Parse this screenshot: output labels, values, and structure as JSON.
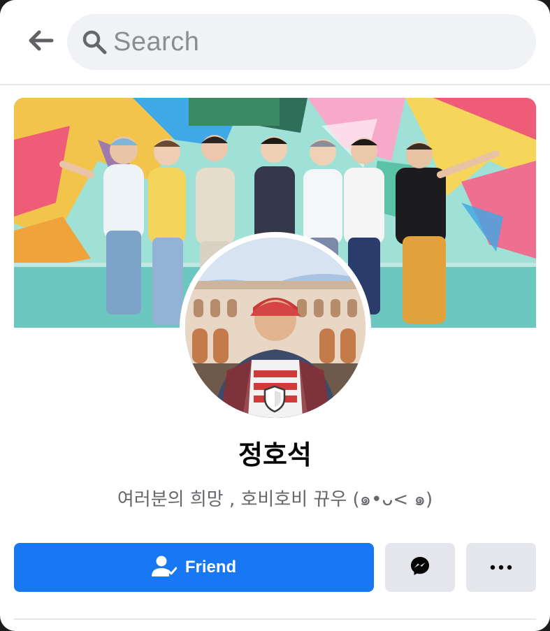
{
  "search": {
    "placeholder": "Search"
  },
  "profile": {
    "name": "정호석",
    "bio": "여러분의 희망 , 호비호비 뀨우 (๑•ᴗ< ๑)"
  },
  "actions": {
    "friend_label": "Friend"
  },
  "icons": {
    "back": "back-arrow-icon",
    "search": "search-icon",
    "friend": "friend-check-icon",
    "messenger": "messenger-icon",
    "more": "more-dots-icon",
    "shield": "profile-guard-shield-icon"
  },
  "colors": {
    "primary": "#1877f2",
    "secondary_button": "#e4e6eb",
    "search_bg": "#f0f2f5",
    "name_text": "#050505",
    "bio_text": "#65676b"
  }
}
